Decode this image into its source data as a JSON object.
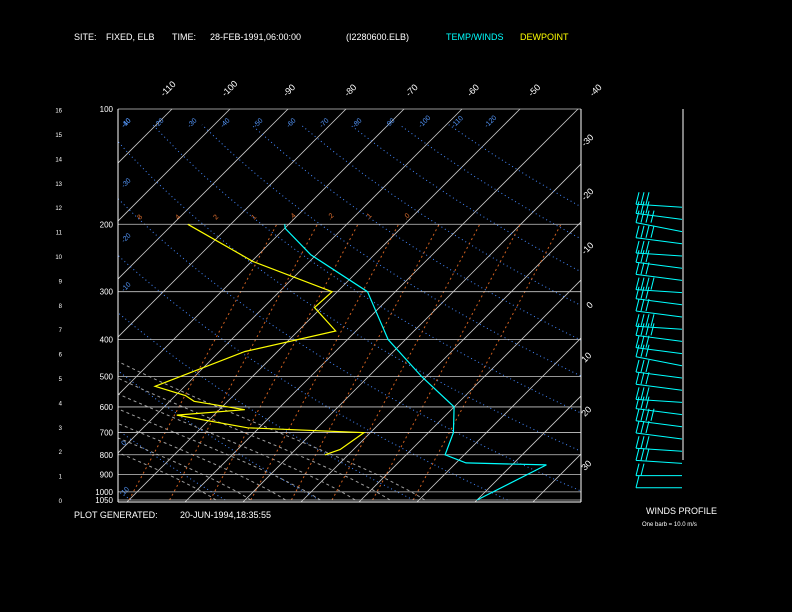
{
  "header": {
    "site_label": "SITE:",
    "site_value": "FIXED, ELB",
    "time_label": "TIME:",
    "time_value": "28-FEB-1991,06:00:00",
    "file_id": "(I2280600.ELB)",
    "legend_temp_winds": "TEMP/WINDS",
    "legend_dewpoint": "DEWPOINT"
  },
  "footer": {
    "plot_generated_label": "PLOT GENERATED:",
    "plot_generated_value": "20-JUN-1994,18:35:55",
    "winds_profile_label": "WINDS PROFILE",
    "barb_note": "One barb = 10.0 m/s"
  },
  "colors": {
    "background": "#000000",
    "temperature": "#00ffff",
    "dewpoint": "#ffff00",
    "isotherm": "#c8c8c8",
    "dry_adiabat": "#4488ff",
    "moist_adiabat": "#a0a0a0",
    "mixing_ratio": "#d06020",
    "pressure_line": "#c8c8c8",
    "wind_barb": "#00ffff"
  },
  "chart_data": {
    "type": "skew-t",
    "pressure_axis": {
      "scale": "log",
      "range_mb": [
        1050,
        100
      ],
      "labels": [
        "100",
        "200",
        "300",
        "400",
        "500",
        "600",
        "700",
        "800",
        "900",
        "1000",
        "1050"
      ],
      "levels": [
        100,
        200,
        300,
        400,
        500,
        600,
        700,
        800,
        900,
        1000,
        1050
      ]
    },
    "height_axis": {
      "labels": [
        "16",
        "15",
        "14",
        "13",
        "12",
        "11",
        "10",
        "9",
        "8",
        "7",
        "6",
        "5",
        "4",
        "3",
        "2",
        "1",
        "0"
      ],
      "values": [
        16,
        15,
        14,
        13,
        12,
        11,
        10,
        9,
        8,
        7,
        6,
        5,
        4,
        3,
        2,
        1,
        0
      ]
    },
    "isotherm_labels_top": [
      "-110",
      "-100",
      "-90",
      "-80",
      "-70",
      "-60",
      "-50",
      "-40"
    ],
    "isotherm_labels_right": [
      "-30",
      "-20",
      "-10",
      "0",
      "10",
      "20",
      "30"
    ],
    "dry_adiabat_labels": [
      "10",
      "0",
      "-10",
      "-20",
      "-30",
      "-40",
      "-50",
      "-60",
      "-70",
      "-80",
      "-90",
      "-100",
      "-110",
      "-120"
    ],
    "mixing_ratio_labels": [
      "8",
      "4",
      "2",
      "1",
      ".4",
      ".2",
      ".1",
      ".0"
    ],
    "series": [
      {
        "name": "TEMP/WINDS",
        "points": [
          {
            "p": 1050,
            "t": 40.0
          },
          {
            "p": 850,
            "t": 45.9
          },
          {
            "p": 840,
            "t": 31.7
          },
          {
            "p": 800,
            "t": 26.7
          },
          {
            "p": 700,
            "t": 24.3
          },
          {
            "p": 600,
            "t": 20.0
          },
          {
            "p": 500,
            "t": 9.2
          },
          {
            "p": 400,
            "t": -3.0
          },
          {
            "p": 300,
            "t": -14.8
          },
          {
            "p": 240,
            "t": -31.0
          },
          {
            "p": 205,
            "t": -39.9
          },
          {
            "p": 200,
            "t": -40.7
          }
        ]
      },
      {
        "name": "DEWPOINT",
        "points": [
          {
            "p": 800,
            "t": 6.0
          },
          {
            "p": 775,
            "t": 7.7
          },
          {
            "p": 700,
            "t": 8.9
          },
          {
            "p": 680,
            "t": -12.0
          },
          {
            "p": 630,
            "t": -26.4
          },
          {
            "p": 610,
            "t": -15.6
          },
          {
            "p": 580,
            "t": -25.8
          },
          {
            "p": 560,
            "t": -28.3
          },
          {
            "p": 530,
            "t": -35.1
          },
          {
            "p": 430,
            "t": -25.6
          },
          {
            "p": 380,
            "t": -13.5
          },
          {
            "p": 330,
            "t": -21.2
          },
          {
            "p": 300,
            "t": -20.9
          },
          {
            "p": 250,
            "t": -39.8
          },
          {
            "p": 200,
            "t": -57.4
          }
        ]
      }
    ],
    "winds": {
      "heights_km": [
        0.5,
        1,
        1.5,
        2,
        2.5,
        3,
        3.5,
        4,
        4.5,
        5,
        5.5,
        6,
        6.5,
        7,
        7.5,
        8,
        8.5,
        9,
        9.5,
        10,
        10.5,
        11,
        11.5,
        12
      ],
      "speed_ms": [
        10,
        20,
        25,
        30,
        30,
        35,
        30,
        25,
        30,
        30,
        25,
        30,
        35,
        35,
        30,
        30,
        35,
        30,
        30,
        30,
        35,
        35,
        30,
        25
      ],
      "direction_deg": [
        270,
        270,
        275,
        275,
        280,
        280,
        280,
        275,
        280,
        280,
        285,
        280,
        280,
        275,
        280,
        280,
        275,
        280,
        280,
        275,
        280,
        285,
        280,
        275
      ]
    }
  }
}
